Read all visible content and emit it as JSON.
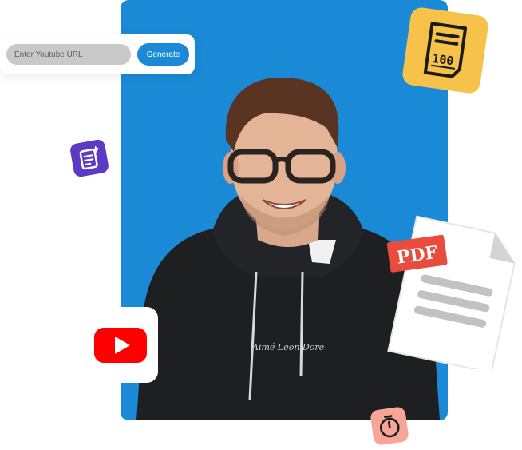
{
  "url_form": {
    "placeholder": "Enter Youtube URL",
    "generate_label": "Generate"
  },
  "pdf_badge": {
    "label": "PDF"
  },
  "score_badge": {
    "score": "100"
  },
  "hoodie_text": "Aimé Leon Dore",
  "icons": [
    "youtube-icon",
    "document-ai-icon",
    "score-paper-icon",
    "pdf-document-icon",
    "timer-icon"
  ],
  "colors": {
    "brand_blue": "#1a8ad6",
    "youtube_red": "#ff0000",
    "score_badge": "#f6c24a",
    "ai_badge": "#5b3ac4",
    "timer_badge": "#f7a596",
    "pdf_red": "#e94b3c"
  }
}
